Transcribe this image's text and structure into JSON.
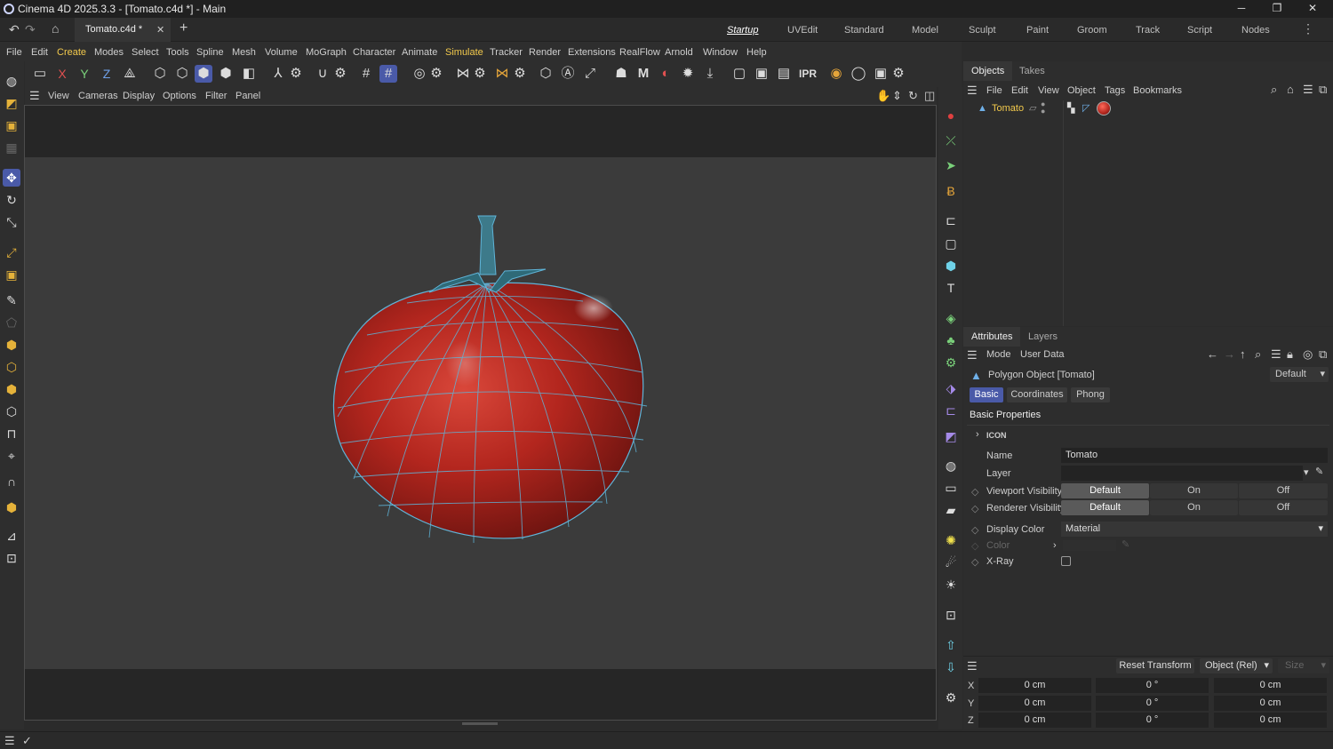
{
  "title_bar": {
    "title": "Cinema 4D 2025.3.3 - [Tomato.c4d *] - Main",
    "minimize": "─",
    "maximize": "❐",
    "close": "✕"
  },
  "tabs": {
    "active": "Tomato.c4d *",
    "close": "✕",
    "add": "+"
  },
  "layouts": [
    "Startup",
    "UVEdit",
    "Standard",
    "Model",
    "Sculpt",
    "Paint",
    "Groom",
    "Track",
    "Script",
    "Nodes"
  ],
  "menu": [
    "File",
    "Edit",
    "Create",
    "Modes",
    "Select",
    "Tools",
    "Spline",
    "Mesh",
    "Volume",
    "MoGraph",
    "Character",
    "Animate",
    "Simulate",
    "Tracker",
    "Render",
    "Extensions",
    "RealFlow",
    "Arnold",
    "Window",
    "Help"
  ],
  "toolbar": {
    "x": "X",
    "y": "Y",
    "z": "Z",
    "ipr": "IPR",
    "m": "M"
  },
  "viewport_menu": [
    "View",
    "Cameras",
    "Display",
    "Options",
    "Filter",
    "Panel"
  ],
  "objects_panel": {
    "tabs": [
      "Objects",
      "Takes"
    ],
    "menu": [
      "File",
      "Edit",
      "View",
      "Object",
      "Tags",
      "Bookmarks"
    ],
    "object_name": "Tomato"
  },
  "attributes_panel": {
    "tabs": [
      "Attributes",
      "Layers"
    ],
    "menu": [
      "Mode",
      "User Data"
    ],
    "object_title": "Polygon Object [Tomato]",
    "preset": "Default",
    "subtabs": [
      "Basic",
      "Coordinates",
      "Phong"
    ],
    "section": "Basic Properties",
    "icon_group": "ICON",
    "name_label": "Name",
    "name_value": "Tomato",
    "layer_label": "Layer",
    "viewport_vis_label": "Viewport Visibility",
    "renderer_vis_label": "Renderer Visibility",
    "vis_options": [
      "Default",
      "On",
      "Off"
    ],
    "display_color_label": "Display Color",
    "display_color_value": "Material",
    "color_label": "Color",
    "xray_label": "X-Ray"
  },
  "coordinates": {
    "reset": "Reset Transform",
    "mode": "Object (Rel)",
    "size": "Size",
    "rows": [
      {
        "axis": "X",
        "pos": "0 cm",
        "rot": "0 °",
        "scale": "0 cm"
      },
      {
        "axis": "Y",
        "pos": "0 cm",
        "rot": "0 °",
        "scale": "0 cm"
      },
      {
        "axis": "Z",
        "pos": "0 cm",
        "rot": "0 °",
        "scale": "0 cm"
      }
    ]
  },
  "colors": {
    "accent": "#4a5aa8",
    "tomato": "#b3261e",
    "wire": "#5fb4d8",
    "highlight": "#f2c94c"
  }
}
